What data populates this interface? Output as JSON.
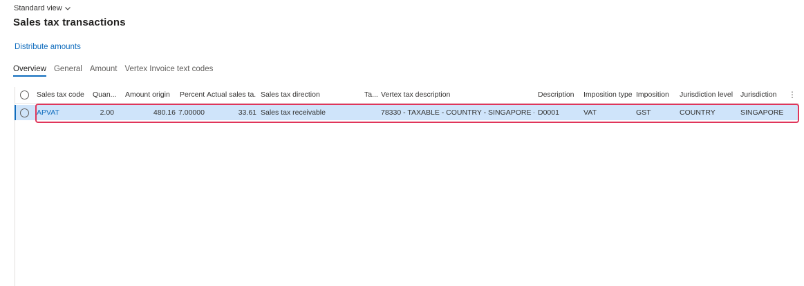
{
  "header": {
    "view_name": "Standard view",
    "title": "Sales tax transactions"
  },
  "actions": {
    "distribute_amounts": "Distribute amounts"
  },
  "tabs": [
    {
      "label": "Overview",
      "active": true
    },
    {
      "label": "General",
      "active": false
    },
    {
      "label": "Amount",
      "active": false
    },
    {
      "label": "Vertex Invoice text codes",
      "active": false
    }
  ],
  "grid": {
    "columns": [
      "Sales tax code",
      "Quan...",
      "Amount origin",
      "Percent",
      "Actual sales ta...",
      "Sales tax direction",
      "Ta...",
      "Vertex tax description",
      "Description",
      "Imposition type",
      "Imposition",
      "Jurisdiction level",
      "Jurisdiction"
    ],
    "rows": [
      {
        "sales_tax_code": "APVAT",
        "quantity": "2.00",
        "amount_origin": "480.16",
        "percent": "7.00000",
        "actual_sales_tax": "33.61",
        "sales_tax_direction": "Sales tax receivable",
        "ta": "",
        "vertex_tax_description": "78330 - TAXABLE - COUNTRY - SINGAPORE -...",
        "description": "D0001",
        "imposition_type": "VAT",
        "imposition": "GST",
        "jurisdiction_level": "COUNTRY",
        "jurisdiction": "SINGAPORE"
      }
    ]
  },
  "icons": {
    "view_chevron": "chevron-down-icon",
    "more": "more-vertical-icon"
  },
  "colors": {
    "accent": "#0f6cbd",
    "selected_row": "#cfe4fa",
    "highlight": "#e0355a"
  }
}
